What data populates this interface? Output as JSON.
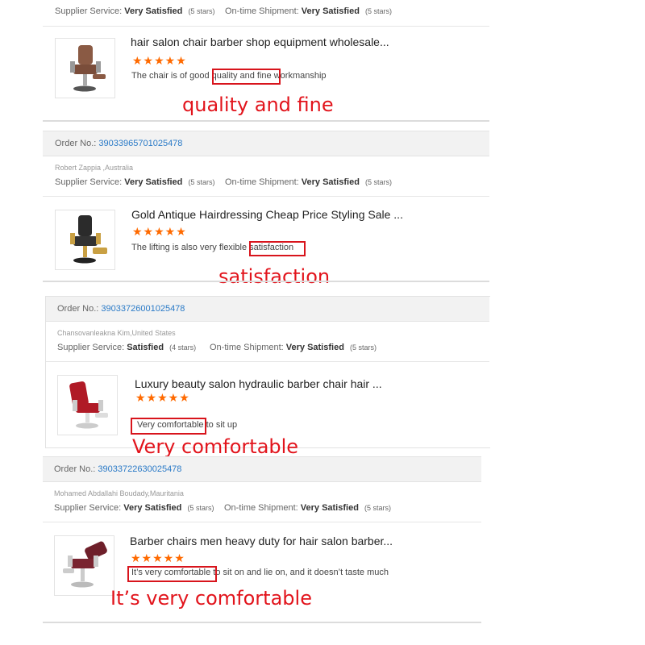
{
  "top_rating": {
    "supplier_service_label": "Supplier Service:",
    "supplier_service_value": "Very Satisfied",
    "supplier_service_stars": "(5 stars)",
    "shipment_label": "On-time Shipment:",
    "shipment_value": "Very Satisfied",
    "shipment_stars": "(5 stars)"
  },
  "orders": [
    {
      "product_title": "hair salon chair barber shop equipment wholesale...",
      "stars": "★★★★★",
      "review_before": "The chair is of good ",
      "review_highlight": "quality and fine",
      "review_after": " workmanship",
      "callout": "quality and fine",
      "image": "brown-barber-chair-icon"
    },
    {
      "order_label": "Order No.:",
      "order_number": "39033965701025478",
      "buyer": "Robert Zappia ,Australia",
      "supplier_service_label": "Supplier Service:",
      "supplier_service_value": "Very Satisfied",
      "supplier_service_stars": "(5 stars)",
      "shipment_label": "On-time Shipment:",
      "shipment_value": "Very Satisfied",
      "shipment_stars": "(5 stars)",
      "product_title": "Gold Antique Hairdressing Cheap Price Styling Sale ...",
      "stars": "★★★★★",
      "review_before": "The lifting is also very flexible ",
      "review_highlight": "satisfaction",
      "review_after": "",
      "callout": "satisfaction",
      "image": "gold-barber-chair-icon"
    },
    {
      "order_label": "Order No.:",
      "order_number": "39033726001025478",
      "buyer": "Chansovanleakna Kim,United States",
      "supplier_service_label": "Supplier Service:",
      "supplier_service_value": "Satisfied",
      "supplier_service_stars": "(4 stars)",
      "shipment_label": "On-time Shipment:",
      "shipment_value": "Very Satisfied",
      "shipment_stars": "(5 stars)",
      "product_title": "Luxury beauty salon hydraulic barber chair hair ...",
      "stars": "★★★★★",
      "review_before": "",
      "review_highlight": "Very comfortable",
      "review_after": " to sit up",
      "callout": "Very comfortable",
      "image": "red-barber-chair-icon"
    },
    {
      "order_label": "Order No.:",
      "order_number": "39033722630025478",
      "buyer": "Mohamed Abdallahi Boudady,Mauritania",
      "supplier_service_label": "Supplier Service:",
      "supplier_service_value": "Very Satisfied",
      "supplier_service_stars": "(5 stars)",
      "shipment_label": "On-time Shipment:",
      "shipment_value": "Very Satisfied",
      "shipment_stars": "(5 stars)",
      "product_title": "Barber chairs men heavy duty for hair salon barber...",
      "stars": "★★★★★",
      "review_before": "",
      "review_highlight": "It’s very comfortable",
      "review_after": " to sit on and lie on, and it doesn’t taste much",
      "callout": "It’s very comfortable",
      "image": "burgundy-barber-chair-icon"
    }
  ],
  "colors": {
    "accent_orange": "#ff6a00",
    "link_blue": "#2a7ac7",
    "highlight_red": "#d8141c",
    "header_gray": "#f2f2f2"
  }
}
